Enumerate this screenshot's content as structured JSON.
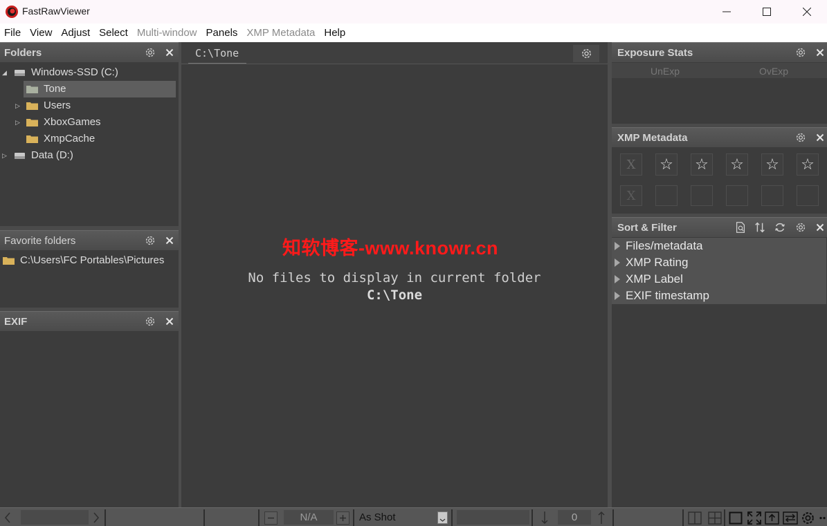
{
  "window": {
    "title": "FastRawViewer"
  },
  "menu": {
    "items": [
      {
        "label": "File",
        "disabled": false
      },
      {
        "label": "View",
        "disabled": false
      },
      {
        "label": "Adjust",
        "disabled": false
      },
      {
        "label": "Select",
        "disabled": false
      },
      {
        "label": "Multi-window",
        "disabled": true
      },
      {
        "label": "Panels",
        "disabled": false
      },
      {
        "label": "XMP Metadata",
        "disabled": true
      },
      {
        "label": "Help",
        "disabled": false
      }
    ]
  },
  "folders_panel": {
    "title": "Folders",
    "tree": [
      {
        "label": "Windows-SSD (C:)",
        "type": "drive",
        "expanded": true
      },
      {
        "label": "Tone",
        "type": "folder",
        "selected": true
      },
      {
        "label": "Users",
        "type": "folder",
        "collapsed": true
      },
      {
        "label": "XboxGames",
        "type": "folder",
        "collapsed": true
      },
      {
        "label": "XmpCache",
        "type": "folder"
      },
      {
        "label": "Data (D:)",
        "type": "drive",
        "collapsed": true
      }
    ]
  },
  "favorites_panel": {
    "title": "Favorite folders",
    "items": [
      "C:\\Users\\FC Portables\\Pictures"
    ]
  },
  "exif_panel": {
    "title": "EXIF"
  },
  "browser": {
    "path_tab": "C:\\Tone",
    "empty_message": "No files to display in current folder",
    "empty_path": "C:\\Tone",
    "watermark": "知软博客-www.knowr.cn"
  },
  "exposure_panel": {
    "title": "Exposure Stats",
    "col_unexp": "UnExp",
    "col_ovexp": "OvExp"
  },
  "xmp_panel": {
    "title": "XMP Metadata",
    "reject_glyph": "X",
    "rating_glyph": "☆",
    "rating_slots": 5
  },
  "sort_panel": {
    "title": "Sort & Filter",
    "groups": [
      "Files/metadata",
      "XMP Rating",
      "XMP Label",
      "EXIF timestamp"
    ]
  },
  "statusbar": {
    "zoom_value": "N/A",
    "white_balance": "As Shot",
    "counter": "0"
  },
  "colors": {
    "background": "#3c3c3c",
    "panel_header": "#4f4f4f",
    "watermark": "#ff1a1a",
    "folder": "#d9b25a"
  }
}
